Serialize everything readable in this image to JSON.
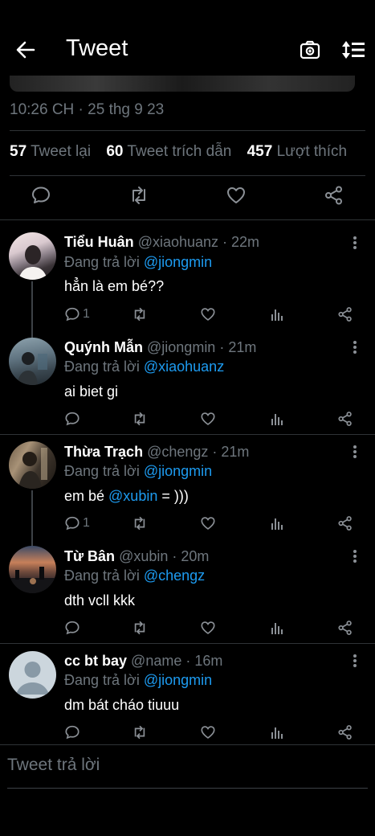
{
  "header": {
    "title": "Tweet"
  },
  "tweet": {
    "timestamp": "10:26 CH · 25 thg 9 23",
    "stats": [
      {
        "value": "57",
        "label": "Tweet lại"
      },
      {
        "value": "60",
        "label": "Tweet trích dẫn"
      },
      {
        "value": "457",
        "label": "Lượt thích"
      }
    ]
  },
  "replies": [
    {
      "name": "Tiểu Huân",
      "meta": "@xiaohuanz · 22m",
      "replying_prefix": "Đang trả lời",
      "replying_to": "@jiongmin",
      "text": "hẳn là em bé??",
      "reply_count": "1"
    },
    {
      "name": "Quýnh Mẫn",
      "meta": "@jiongmin · 21m",
      "replying_prefix": "Đang trả lời",
      "replying_to": "@xiaohuanz",
      "text": "ai biet gi",
      "reply_count": ""
    },
    {
      "name": "Thừa Trạch",
      "meta": "@chengz · 21m",
      "replying_prefix": "Đang trả lời",
      "replying_to": "@jiongmin",
      "text_before": "em bé ",
      "mention": "@xubin",
      "text_after": " = )))",
      "reply_count": "1"
    },
    {
      "name": "Từ Bân",
      "meta": "@xubin · 20m",
      "replying_prefix": "Đang trả lời",
      "replying_to": "@chengz",
      "text": "dth vcll kkk",
      "reply_count": ""
    },
    {
      "name": "cc bt bay",
      "meta": "@name · 16m",
      "replying_prefix": "Đang trả lời",
      "replying_to": "@jiongmin",
      "text": "dm bát cháo tiuuu",
      "reply_count": ""
    }
  ],
  "compose": {
    "placeholder": "Tweet trả lời"
  },
  "colors": {
    "accent": "#1d9bf0",
    "muted": "#6e767d",
    "background": "#000000"
  },
  "icons": [
    "back-arrow-icon",
    "camera-icon",
    "sort-icon",
    "comment-icon",
    "retweet-icon",
    "like-icon",
    "share-icon",
    "analytics-icon",
    "more-icon"
  ]
}
